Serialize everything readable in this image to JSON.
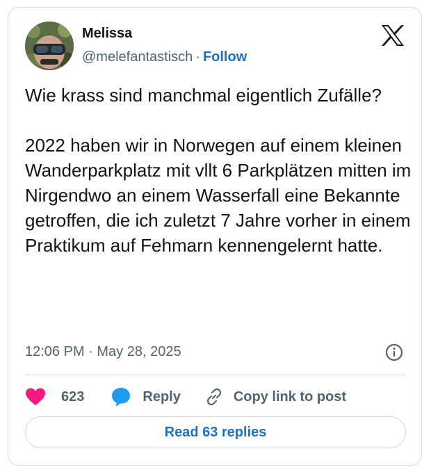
{
  "author": {
    "display_name": "Melissa",
    "handle": "@melefantastisch",
    "separator": "·",
    "follow_label": "Follow"
  },
  "tweet": {
    "paragraphs": [
      "Wie krass sind manchmal eigentlich Zufälle?",
      "2022 haben wir in Norwegen auf einem kleinen Wanderparkplatz mit vllt 6 Parkplätzen mitten im Nirgendwo an einem Wasserfall eine Bekannte getroffen, die ich zuletzt 7 Jahre vorher in einem Praktikum auf Fehmarn kennengelernt hatte."
    ],
    "timestamp": "12:06 PM · May 28, 2025"
  },
  "actions": {
    "like_count": "623",
    "reply_label": "Reply",
    "copy_link_label": "Copy link to post"
  },
  "read_replies_label": "Read 63 replies",
  "icons": {
    "logo": "x-logo-icon",
    "info": "info-icon",
    "like": "heart-icon",
    "reply": "reply-bubble-icon",
    "copy": "link-icon"
  },
  "colors": {
    "text_primary": "#0f1419",
    "text_secondary": "#536471",
    "link_blue": "#1d71c4",
    "heart_pink": "#f91880",
    "reply_blue": "#1d9bf0",
    "border": "#cfd9de"
  }
}
